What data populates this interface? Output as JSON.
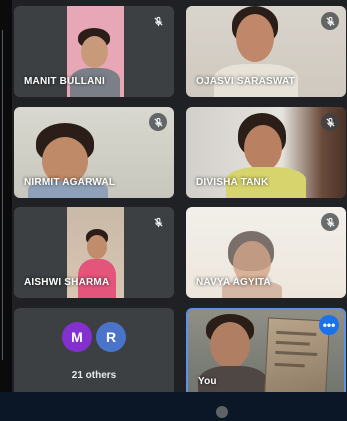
{
  "participants": [
    {
      "name": "MANIT BULLANI",
      "muted": true
    },
    {
      "name": "OJASVI SARASWAT",
      "muted": true
    },
    {
      "name": "NIRMIT AGARWAL",
      "muted": true
    },
    {
      "name": "DIVISHA TANK",
      "muted": true
    },
    {
      "name": "AISHWI SHARMA",
      "muted": true
    },
    {
      "name": "NAVYA AGYITA",
      "muted": true
    }
  ],
  "others_tile": {
    "avatars": [
      {
        "letter": "M",
        "color": "#8430ce"
      },
      {
        "letter": "R",
        "color": "#4a74c9"
      }
    ],
    "label": "21 others"
  },
  "self_tile": {
    "name": "You",
    "more_label": "•••"
  },
  "colors": {
    "tile_bg": "#3c4043",
    "page_bg": "#202124",
    "self_border": "#5c93e8",
    "more_button": "#1a73e8"
  },
  "icons": {
    "mic": "mic-off-icon",
    "more": "more-options-icon"
  }
}
